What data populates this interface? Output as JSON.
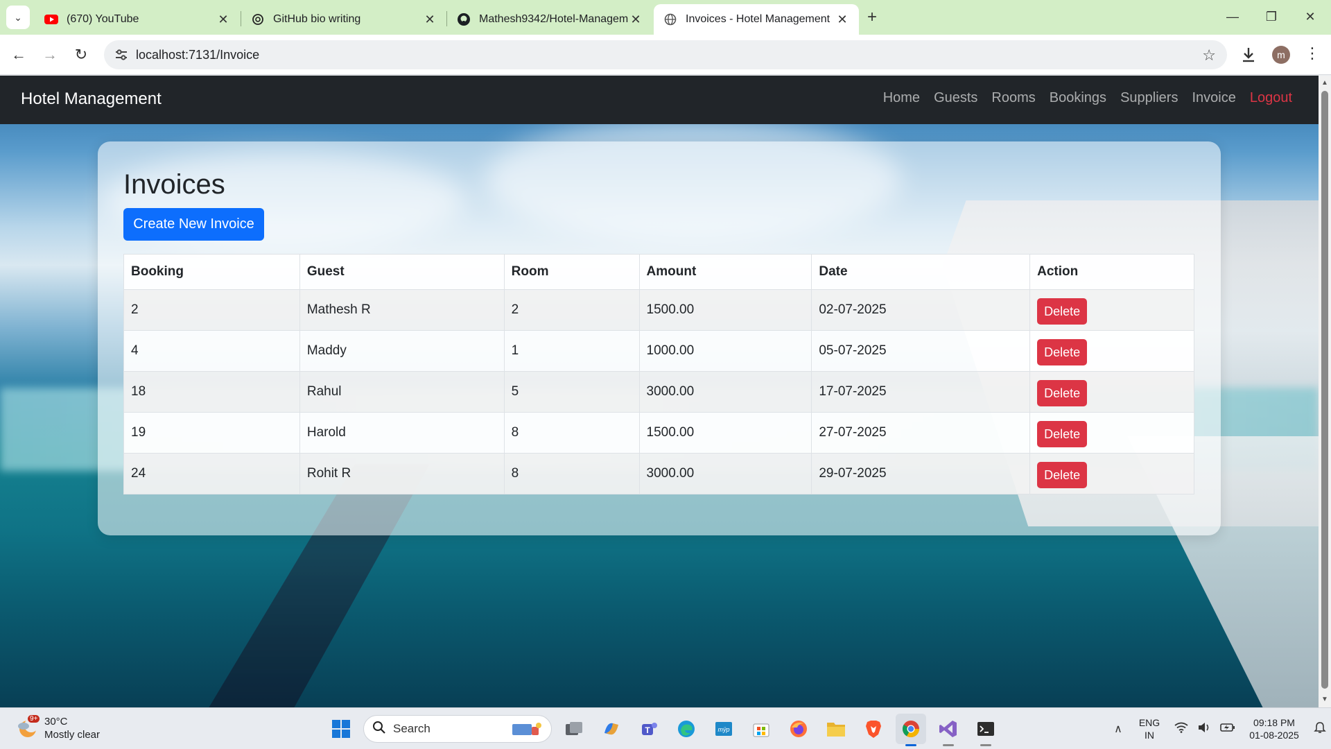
{
  "browser": {
    "tabs": [
      {
        "title": "(670) YouTube",
        "icon": "youtube-icon",
        "active": false
      },
      {
        "title": "GitHub bio writing",
        "icon": "openai-icon",
        "active": false
      },
      {
        "title": "Mathesh9342/Hotel-Management",
        "icon": "github-icon",
        "active": false
      },
      {
        "title": "Invoices - Hotel Management",
        "icon": "globe-icon",
        "active": true
      }
    ],
    "tab_close_glyph": "✕",
    "url": "localhost:7131/Invoice",
    "profile_initial": "m"
  },
  "site": {
    "brand": "Hotel Management",
    "nav": [
      "Home",
      "Guests",
      "Rooms",
      "Bookings",
      "Suppliers",
      "Invoice"
    ],
    "logout": "Logout",
    "colors": {
      "navbar": "#212529",
      "primary": "#0d6efd",
      "danger": "#dc3545"
    }
  },
  "page": {
    "title": "Invoices",
    "create_button": "Create New Invoice",
    "columns": [
      "Booking",
      "Guest",
      "Room",
      "Amount",
      "Date",
      "Action"
    ],
    "rows": [
      {
        "booking": "2",
        "guest": "Mathesh R",
        "room": "2",
        "amount": "1500.00",
        "date": "02-07-2025",
        "action": "Delete"
      },
      {
        "booking": "4",
        "guest": "Maddy",
        "room": "1",
        "amount": "1000.00",
        "date": "05-07-2025",
        "action": "Delete"
      },
      {
        "booking": "18",
        "guest": "Rahul",
        "room": "5",
        "amount": "3000.00",
        "date": "17-07-2025",
        "action": "Delete"
      },
      {
        "booking": "19",
        "guest": "Harold",
        "room": "8",
        "amount": "1500.00",
        "date": "27-07-2025",
        "action": "Delete"
      },
      {
        "booking": "24",
        "guest": "Rohit R",
        "room": "8",
        "amount": "3000.00",
        "date": "29-07-2025",
        "action": "Delete"
      }
    ]
  },
  "taskbar": {
    "weather_temp": "30°C",
    "weather_desc": "Mostly clear",
    "weather_badge": "9+",
    "search_placeholder": "Search",
    "lang_top": "ENG",
    "lang_bottom": "IN",
    "time": "09:18 PM",
    "date": "01-08-2025"
  }
}
